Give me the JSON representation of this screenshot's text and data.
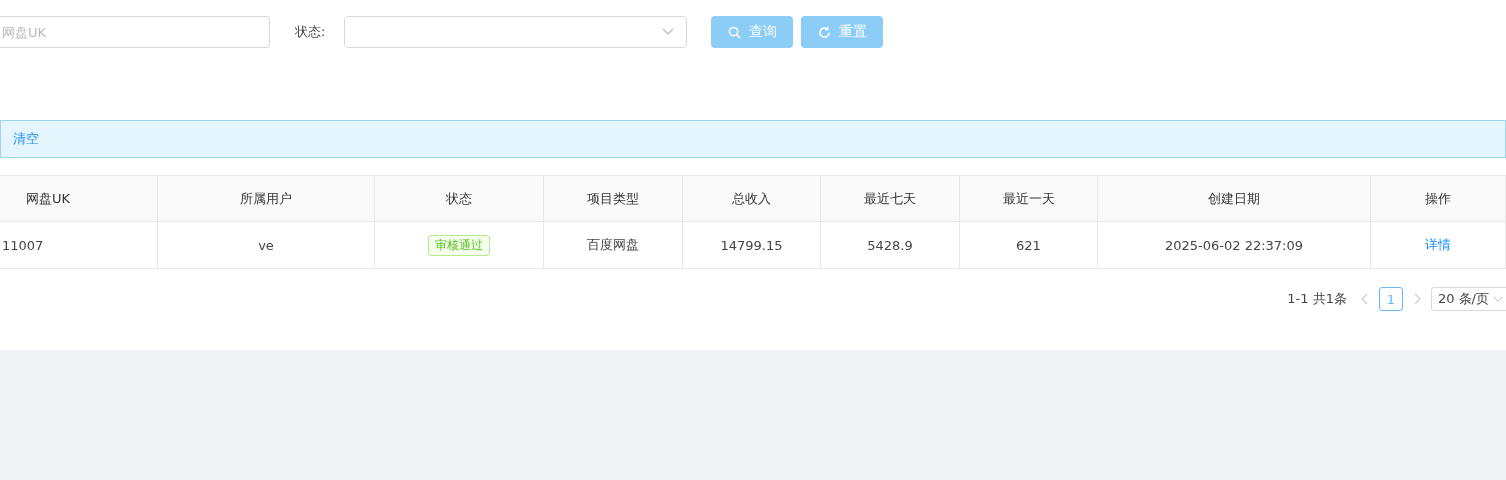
{
  "search": {
    "uk_placeholder": "网盘UK",
    "status_label": "状态:",
    "query_button": "查询",
    "reset_button": "重置"
  },
  "alert": {
    "clear_link": "清空"
  },
  "table": {
    "columns": [
      "网盘UK",
      "所属用户",
      "状态",
      "项目类型",
      "总收入",
      "最近七天",
      "最近一天",
      "创建日期",
      "操作"
    ],
    "rows": [
      {
        "uk": "11007",
        "user": "ve",
        "status": "审核通过",
        "type": "百度网盘",
        "total": "14799.15",
        "seven_days": "5428.9",
        "one_day": "621",
        "created": "2025-06-02 22:37:09",
        "action": "详情"
      }
    ]
  },
  "pagination": {
    "total": "1-1 共1条",
    "pages": [
      {
        "label": "1",
        "selected": true
      }
    ],
    "page_size": "20 条/页"
  }
}
